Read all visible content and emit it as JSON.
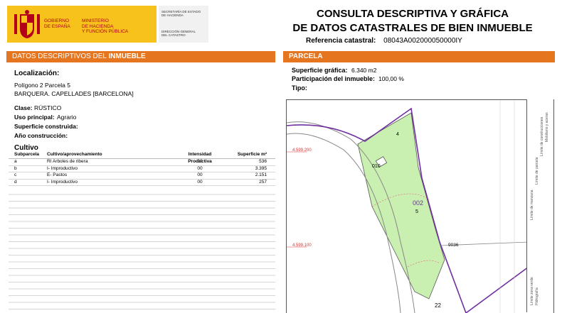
{
  "header": {
    "gov_line1": "GOBIERNO",
    "gov_line2": "DE ESPAÑA",
    "ministry_line1": "MINISTERIO",
    "ministry_line2": "DE HACIENDA",
    "ministry_line3": "Y FUNCIÓN PÚBLICA",
    "sec_line1": "SECRETARÍA DE ESTADO",
    "sec_line2": "DE HACIENDA",
    "dir_line1": "DIRECCIÓN GENERAL",
    "dir_line2": "DEL CATASTRO",
    "title_line1": "CONSULTA DESCRIPTIVA Y GRÁFICA",
    "title_line2": "DE DATOS CATASTRALES DE BIEN INMUEBLE",
    "ref_label": "Referencia catastral:",
    "ref_value": "08043A002000050000IY"
  },
  "left": {
    "band_prefix": "DATOS DESCRIPTIVOS DEL ",
    "band_bold": "INMUEBLE",
    "localizacion_label": "Localización:",
    "loc_line1": "Polígono 2 Parcela 5",
    "loc_line2": "BARQUERA. CAPELLADES [BARCELONA]",
    "clase_label": "Clase:",
    "clase_value": "RÚSTICO",
    "uso_label": "Uso principal:",
    "uso_value": "Agrario",
    "superficie_label": "Superficie construida:",
    "anio_label": "Año construcción:",
    "cultivo_label": "Cultivo",
    "table_headers": [
      "Subparcela",
      "Cultivo/aprovechamiento",
      "Intensidad Productiva",
      "Superficie m²"
    ],
    "rows": [
      {
        "sub": "a",
        "cultivo": "RI Arboles de ribera",
        "intensidad": "00",
        "superficie": "536"
      },
      {
        "sub": "b",
        "cultivo": "I- Improductivo",
        "intensidad": "00",
        "superficie": "3.395"
      },
      {
        "sub": "c",
        "cultivo": "E- Pastos",
        "intensidad": "00",
        "superficie": "2.151"
      },
      {
        "sub": "d",
        "cultivo": "I- Improductivo",
        "intensidad": "00",
        "superficie": "257"
      }
    ]
  },
  "right": {
    "band": "PARCELA",
    "sup_label": "Superficie gráfica:",
    "sup_value": "6.340 m2",
    "part_label": "Participación del inmueble:",
    "part_value": "100,00 %",
    "tipo_label": "Tipo:"
  },
  "map": {
    "coord_top": "4.599.200",
    "coord_bottom": "4.599.100",
    "label_4": "4",
    "label_010": "010",
    "label_002": "002",
    "label_5": "5",
    "label_9036": "9036",
    "label_22": "22",
    "legend_lines": [
      "Límite de manzana",
      "Límite de parcela",
      "Límite de construcciones",
      "Mobiliario y aceras",
      "Límite zona verde",
      "Hidrografía"
    ],
    "colors": {
      "parcel_fill": "#c9f0b0",
      "boundary": "#7030a0",
      "accent": "#e5751f"
    }
  }
}
